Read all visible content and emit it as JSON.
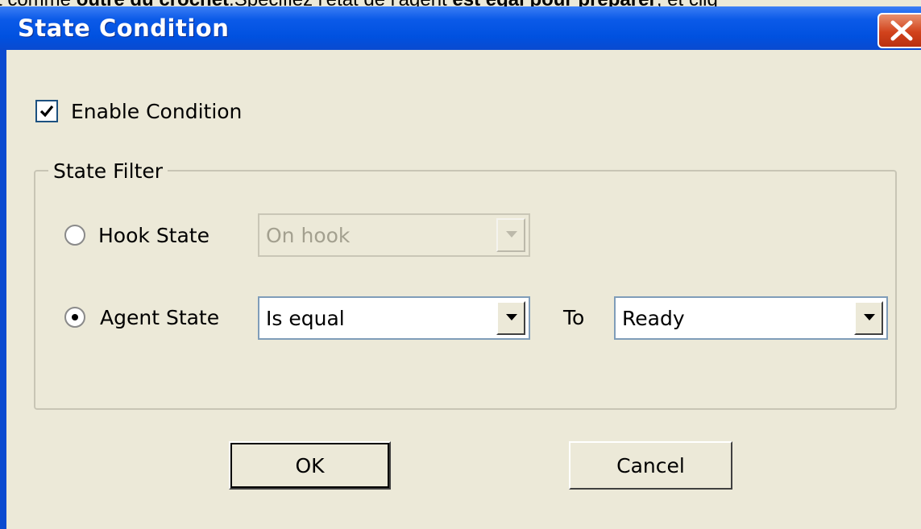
{
  "doc_overlay": {
    "part1": "t comme ",
    "part2": "outre du crochet",
    "part3": ".Spécifiez l'état de l'agent ",
    "part4": "est égal pour préparer",
    "part5": ", et cliq"
  },
  "window": {
    "title": "State Condition",
    "close_icon": "close-icon"
  },
  "enable_condition": {
    "label": "Enable Condition",
    "checked": true
  },
  "state_filter": {
    "label": "State Filter",
    "hook_state": {
      "label": "Hook State",
      "selected": false,
      "value": "On hook",
      "enabled": false
    },
    "agent_state": {
      "label": "Agent State",
      "selected": true,
      "operator": "Is equal",
      "to_label": "To",
      "value": "Ready"
    }
  },
  "buttons": {
    "ok": "OK",
    "cancel": "Cancel"
  },
  "colors": {
    "titlebar": "#0051e0",
    "dialog_bg": "#ece9d8",
    "close_red": "#d2431c"
  }
}
